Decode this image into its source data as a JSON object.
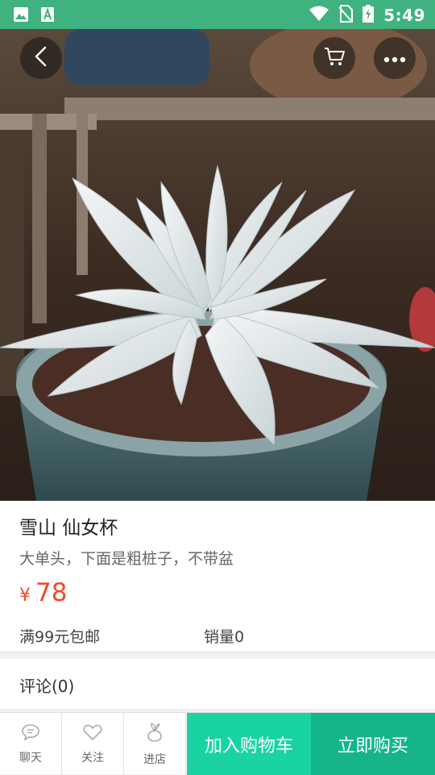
{
  "status_bar": {
    "time": "5:49"
  },
  "product": {
    "title": "雪山 仙女杯",
    "subtitle": "大单头，下面是粗桩子，不带盆",
    "currency": "¥",
    "price": "78",
    "shipping": "满99元包邮",
    "sales": "销量0"
  },
  "comments": {
    "label": "评论(0)"
  },
  "bottom_bar": {
    "chat": "聊天",
    "follow": "关注",
    "store": "进店",
    "add_to_cart": "加入购物车",
    "buy_now": "立即购买"
  },
  "colors": {
    "status_bar": "#3fb27f",
    "price": "#f04a2a",
    "add_to_cart": "#19d4a2",
    "buy_now": "#15b489"
  }
}
